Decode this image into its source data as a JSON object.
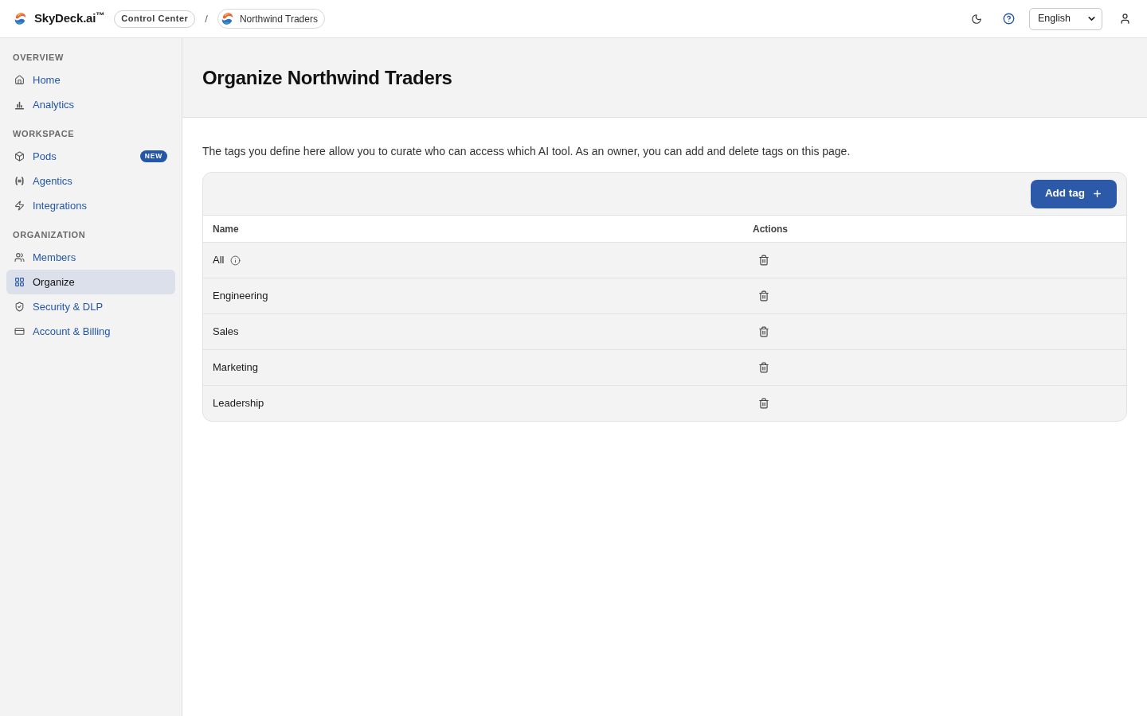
{
  "header": {
    "brand": "SkyDeck.ai$^{™}$",
    "context_pill": "Control Center",
    "separator": "/",
    "organization": "Northwind Traders",
    "language": "English"
  },
  "sidebar": {
    "sections": [
      {
        "title": "OVERVIEW",
        "items": [
          {
            "label": "Home",
            "selected": false
          },
          {
            "label": "Analytics",
            "selected": false
          }
        ]
      },
      {
        "title": "WORKSPACE",
        "items": [
          {
            "label": "Pods",
            "selected": false,
            "badge": "NEW"
          },
          {
            "label": "Agentics",
            "selected": false
          },
          {
            "label": "Integrations",
            "selected": false
          }
        ]
      },
      {
        "title": "ORGANIZATION",
        "items": [
          {
            "label": "Members",
            "selected": false
          },
          {
            "label": "Organize",
            "selected": true
          },
          {
            "label": "Security & DLP",
            "selected": false
          },
          {
            "label": "Account & Billing",
            "selected": false
          }
        ]
      }
    ]
  },
  "page": {
    "title": "Organize Northwind Traders",
    "description": "The tags you define here allow you to curate who can access which AI tool. As an owner, you can add and delete tags on this page."
  },
  "table": {
    "add_button": "Add tag",
    "columns": [
      "Name",
      "Actions"
    ],
    "rows": [
      {
        "name": "All",
        "info": true
      },
      {
        "name": "Engineering",
        "info": false
      },
      {
        "name": "Sales",
        "info": false
      },
      {
        "name": "Marketing",
        "info": false
      },
      {
        "name": "Leadership",
        "info": false
      }
    ]
  }
}
